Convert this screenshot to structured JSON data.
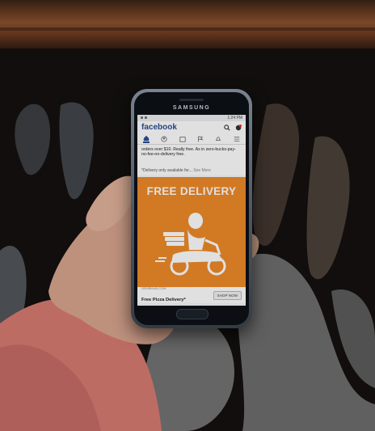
{
  "phone": {
    "brand": "SAMSUNG"
  },
  "status_bar": {
    "time": "1:24 PM"
  },
  "facebook": {
    "logo": "facebook",
    "post_text": "orders over $10. Really free. As in zero-bucks-pay-no-fee-on-delivery free.",
    "post_note": "*Delivery only available for...",
    "see_more": "See More",
    "ad": {
      "title": "FREE DELIVERY",
      "sponsor_small": "GRUBHUB.COM",
      "headline": "Free Pizza Delivery*",
      "cta": "SHOP NOW"
    }
  },
  "colors": {
    "facebook_blue": "#2c4e92",
    "ad_orange": "#f08a2a",
    "phone_silver": "#7a8794"
  }
}
